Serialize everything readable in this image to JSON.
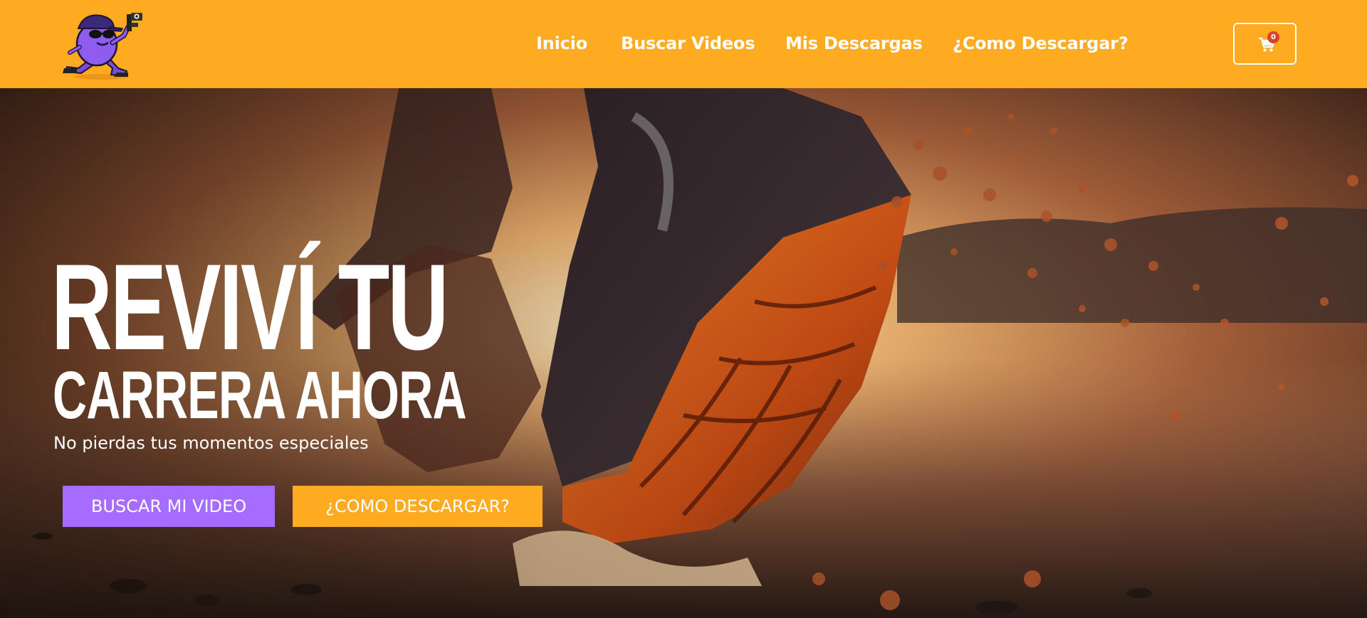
{
  "header": {
    "logo_alt": "Logo",
    "nav": [
      {
        "label": "Inicio"
      },
      {
        "label": "Buscar Videos"
      },
      {
        "label": "Mis Descargas"
      },
      {
        "label": "¿Como Descargar?"
      }
    ],
    "cart": {
      "count": "0",
      "icon": "cart-icon"
    }
  },
  "hero": {
    "title_line1": "REVIVÍ TU",
    "title_line2": "CARRERA AHORA",
    "subtitle": "No pierdas tus momentos especiales",
    "primary_button": "BUSCAR MI VIDEO",
    "secondary_button": "¿COMO DESCARGAR?"
  },
  "colors": {
    "header_bg": "#ffab22",
    "primary_button": "#a66cff",
    "secondary_button": "#ffab22",
    "badge": "#d9452c"
  }
}
